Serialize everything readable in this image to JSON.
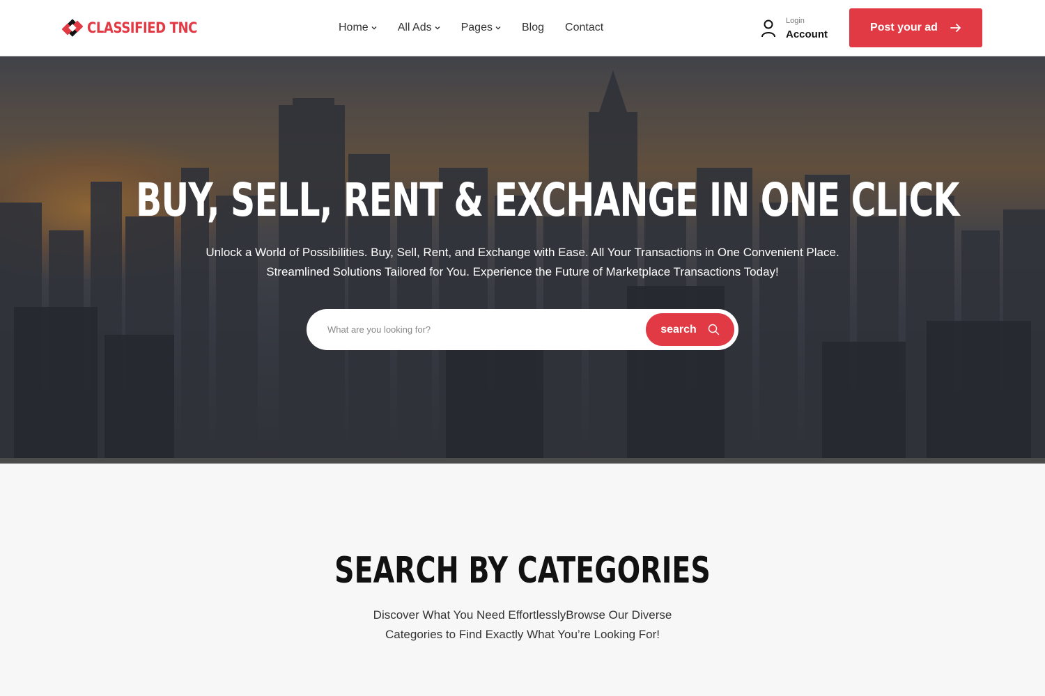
{
  "brand": {
    "name": "CLASSIFIED TNC",
    "accent": "#e13a45"
  },
  "nav": {
    "items": [
      {
        "label": "Home",
        "has_dropdown": true
      },
      {
        "label": "All Ads",
        "has_dropdown": true
      },
      {
        "label": "Pages",
        "has_dropdown": true
      },
      {
        "label": "Blog",
        "has_dropdown": false
      },
      {
        "label": "Contact",
        "has_dropdown": false
      }
    ]
  },
  "account": {
    "login_label": "Login",
    "account_label": "Account",
    "icon": "user-icon"
  },
  "post_ad": {
    "label": "Post your ad",
    "icon": "arrow-right-icon"
  },
  "hero": {
    "title": "BUY, SELL, RENT  & EXCHANGE IN ONE CLICK",
    "subtitle": "Unlock a World of Possibilities. Buy, Sell, Rent, and Exchange with Ease. All Your Transactions in One Convenient Place. Streamlined Solutions Tailored for You. Experience the Future of Marketplace Transactions Today!",
    "search": {
      "placeholder": "What are you looking for?",
      "value": "",
      "button_label": "search",
      "icon": "search-icon"
    }
  },
  "categories": {
    "title": "SEARCH BY CATEGORIES",
    "subtitle": "Discover What You Need EffortlesslyBrowse Our Diverse Categories to Find Exactly What You’re Looking For!"
  }
}
